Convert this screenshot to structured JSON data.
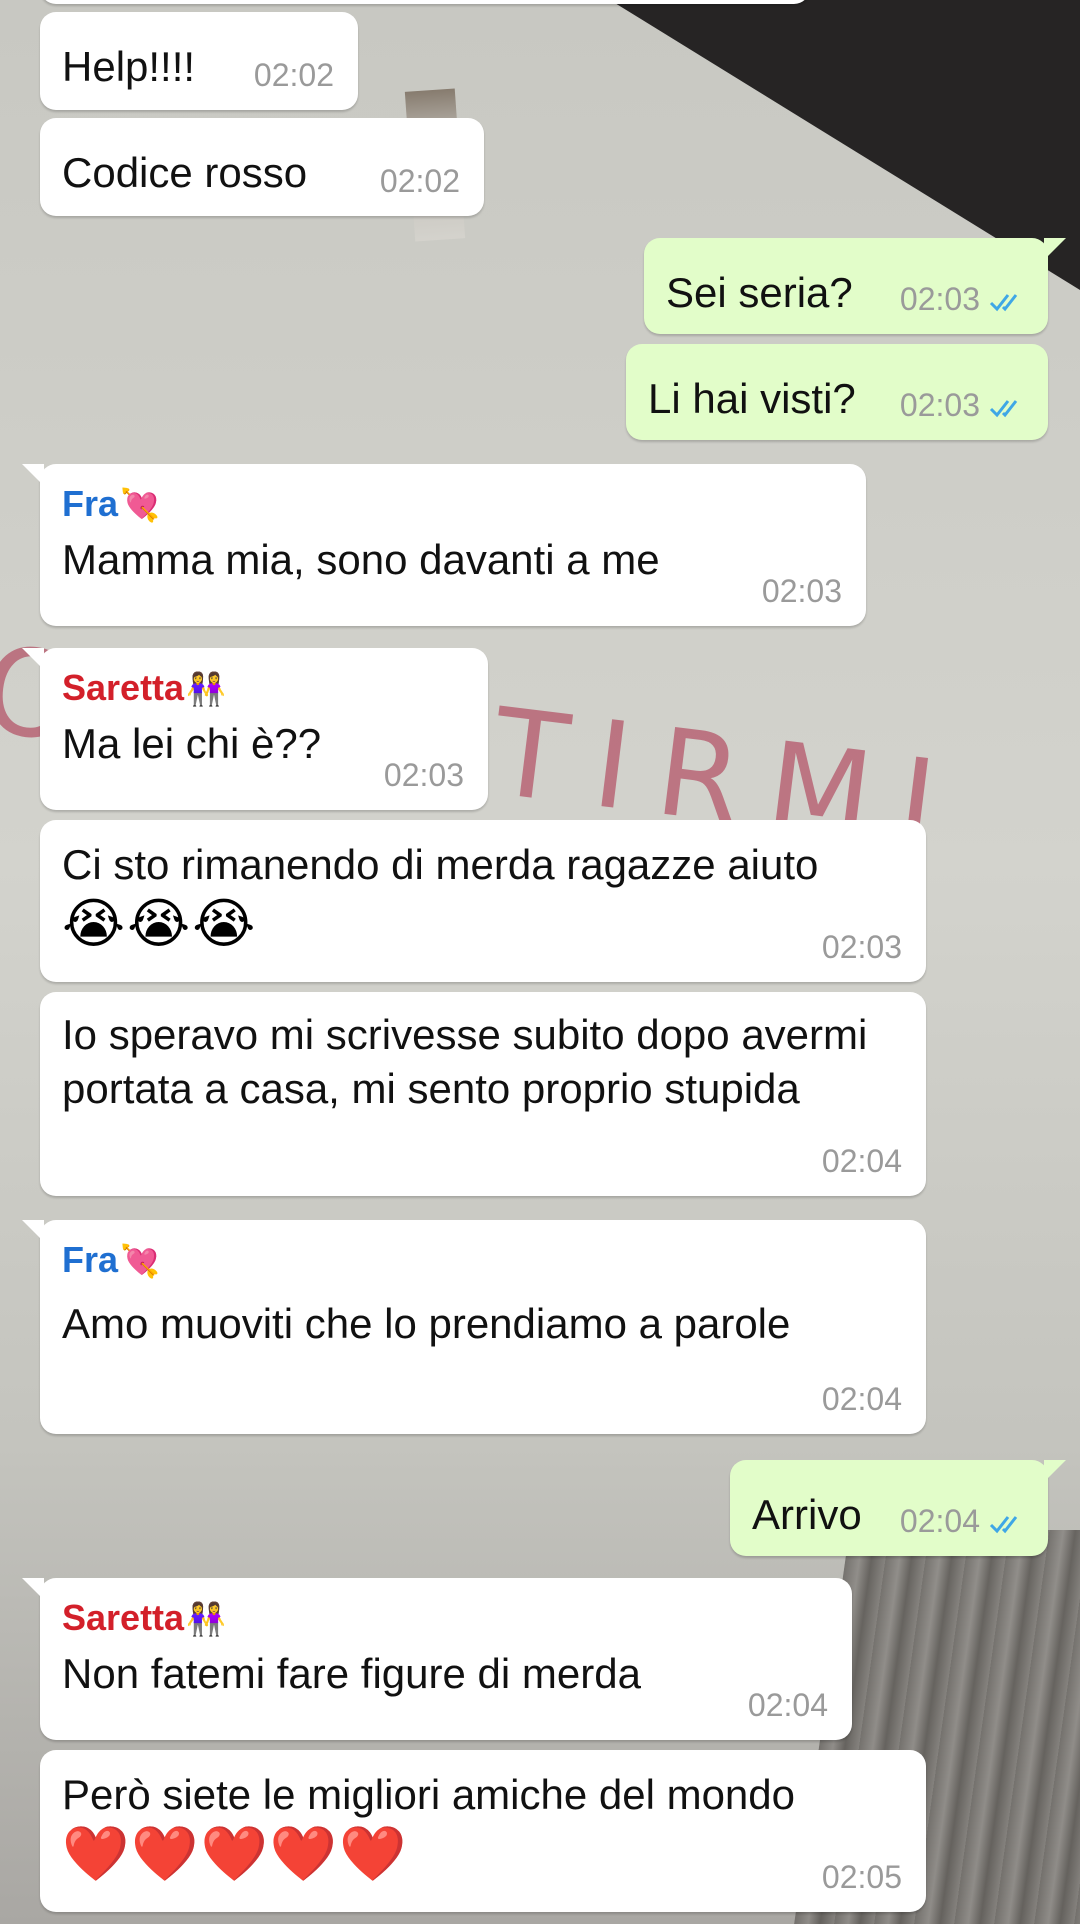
{
  "chat": {
    "messages": [
      {
        "id": "m1",
        "dir": "in",
        "sender": "",
        "sender_emoji": "",
        "text": "Help!!!!",
        "emoji": "",
        "time": "02:02"
      },
      {
        "id": "m2",
        "dir": "in",
        "sender": "",
        "sender_emoji": "",
        "text": "Codice rosso",
        "emoji": "",
        "time": "02:02"
      },
      {
        "id": "m3",
        "dir": "out",
        "sender": "",
        "sender_emoji": "",
        "text": "Sei seria?",
        "emoji": "",
        "time": "02:03",
        "status": "read"
      },
      {
        "id": "m4",
        "dir": "out",
        "sender": "",
        "sender_emoji": "",
        "text": "Li hai visti?",
        "emoji": "",
        "time": "02:03",
        "status": "read"
      },
      {
        "id": "m5",
        "dir": "in",
        "sender": "Fra",
        "sender_emoji": "💘",
        "text": "Mamma mia, sono davanti a me",
        "emoji": "",
        "time": "02:03"
      },
      {
        "id": "m6",
        "dir": "in",
        "sender": "Saretta",
        "sender_emoji": "👭",
        "text": "Ma lei chi è??",
        "emoji": "",
        "time": "02:03"
      },
      {
        "id": "m7",
        "dir": "in",
        "sender": "",
        "sender_emoji": "",
        "text": "Ci sto rimanendo di merda ragazze aiuto",
        "emoji": "😭😭😭",
        "time": "02:03"
      },
      {
        "id": "m8",
        "dir": "in",
        "sender": "",
        "sender_emoji": "",
        "text": "Io speravo mi scrivesse subito dopo avermi portata a casa, mi sento proprio stupida",
        "emoji": "",
        "time": "02:04"
      },
      {
        "id": "m9",
        "dir": "in",
        "sender": "Fra",
        "sender_emoji": "💘",
        "text": "Amo muoviti che lo prendiamo a parole",
        "emoji": "",
        "time": "02:04"
      },
      {
        "id": "m10",
        "dir": "out",
        "sender": "",
        "sender_emoji": "",
        "text": "Arrivo",
        "emoji": "",
        "time": "02:04",
        "status": "read"
      },
      {
        "id": "m11",
        "dir": "in",
        "sender": "Saretta",
        "sender_emoji": "👭",
        "text": "Non fatemi fare figure di merda",
        "emoji": "",
        "time": "02:04"
      },
      {
        "id": "m12",
        "dir": "in",
        "sender": "",
        "sender_emoji": "",
        "text": "Però siete le migliori amiche del mondo",
        "emoji": "❤️❤️❤️❤️❤️",
        "time": "02:05"
      }
    ]
  },
  "colors": {
    "incoming_bubble": "#ffffff",
    "outgoing_bubble": "#e2fdc9",
    "sender_fra": "#1f6fd1",
    "sender_saretta": "#d3202a",
    "timestamp": "#9a9a9a",
    "read_tick": "#3fa7e6"
  },
  "wallpaper": {
    "graffiti_text": "O SENTIRMI"
  }
}
